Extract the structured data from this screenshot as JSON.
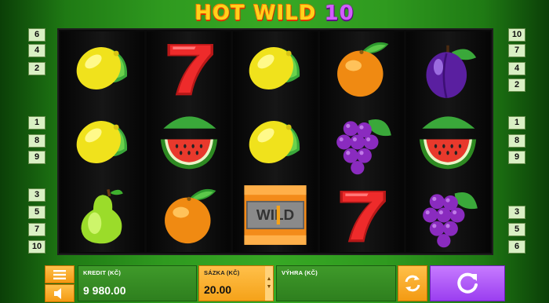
{
  "title": {
    "main": "HOT WILD",
    "number": "10"
  },
  "paylines_left": [
    "6",
    "4",
    "2",
    "1",
    "8",
    "9",
    "3",
    "5",
    "7",
    "10"
  ],
  "paylines_right": [
    "10",
    "7",
    "4",
    "2",
    "1",
    "8",
    "9",
    "3",
    "5",
    "6"
  ],
  "reels": [
    [
      "lemon",
      "lemon",
      "pear"
    ],
    [
      "seven",
      "watermelon",
      "orange"
    ],
    [
      "lemon",
      "lemon",
      "wild"
    ],
    [
      "orange",
      "grapes",
      "seven"
    ],
    [
      "plum",
      "watermelon",
      "grapes"
    ]
  ],
  "wild_text": "WILD",
  "hud": {
    "credit_label": "KREDIT (KČ)",
    "credit_value": "9 980.00",
    "bet_label": "SÁZKA (KČ)",
    "bet_value": "20.00",
    "win_label": "VÝHRA (KČ)",
    "win_value": ""
  },
  "icons": {
    "menu": "menu-icon",
    "sound": "sound-icon",
    "autoplay": "autoplay-icon",
    "spin": "spin-icon"
  },
  "colors": {
    "orange_accent": "#f5a219",
    "spin_purple": "#a24cf3",
    "panel_green": "#3a9226"
  }
}
